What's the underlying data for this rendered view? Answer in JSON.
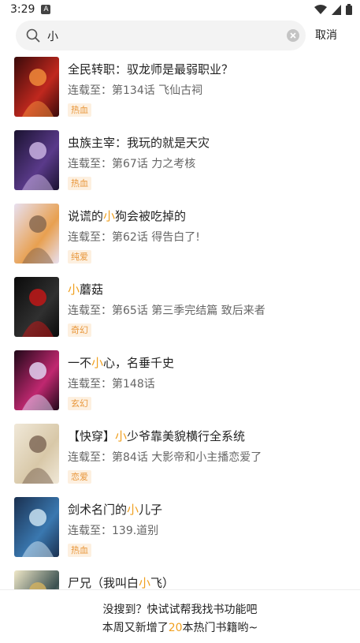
{
  "status": {
    "time": "3:29",
    "notif_glyph": "A"
  },
  "search": {
    "query": "小",
    "placeholder": "",
    "cancel_label": "取消"
  },
  "colors": {
    "accent": "#f0a020",
    "tag_bg": "#fdf0e0",
    "tag_text": "#e8963a"
  },
  "results": [
    {
      "title_parts": [
        "全民转职：驭龙师是最弱职业？"
      ],
      "highlight_index": -1,
      "latest": "连载至：第134话 飞仙古祠",
      "tag": "热血",
      "cover_colors": [
        "#3a0a0a",
        "#c0281e",
        "#f08a3a"
      ]
    },
    {
      "title_parts": [
        "虫族主宰：我玩的就是天灾"
      ],
      "highlight_index": -1,
      "latest": "连载至：第67话 力之考核",
      "tag": "热血",
      "cover_colors": [
        "#1a1230",
        "#5a3a8a",
        "#c8b0e0"
      ]
    },
    {
      "title_parts": [
        "说谎的",
        "小",
        "狗会被吃掉的"
      ],
      "highlight_index": 1,
      "latest": "连载至：第62话 得告白了!",
      "tag": "纯爱",
      "cover_colors": [
        "#e8e0f0",
        "#e8a050",
        "#8a6a50"
      ]
    },
    {
      "title_parts": [
        "小",
        "蘑菇"
      ],
      "highlight_index": 0,
      "latest": "连载至：第65话 第三季完结篇 致后来者",
      "tag": "奇幻",
      "cover_colors": [
        "#0a0a0a",
        "#303030",
        "#c01818"
      ]
    },
    {
      "title_parts": [
        "一不",
        "小",
        "心，名垂千史"
      ],
      "highlight_index": 1,
      "latest": "连载至：第148话",
      "tag": "玄幻",
      "cover_colors": [
        "#200818",
        "#c02870",
        "#e0d0f0"
      ]
    },
    {
      "title_parts": [
        "【快穿】",
        "小",
        "少爷靠美貌横行全系统"
      ],
      "highlight_index": 1,
      "latest": "连载至：第84话 大影帝和小主播恋爱了",
      "tag": "恋爱",
      "cover_colors": [
        "#f0e8d8",
        "#d8c8a8",
        "#806a58"
      ]
    },
    {
      "title_parts": [
        "剑术名门的",
        "小",
        "儿子"
      ],
      "highlight_index": 1,
      "latest": "连载至：139.道别",
      "tag": "热血",
      "cover_colors": [
        "#1a3050",
        "#3a78b0",
        "#c8e0f0"
      ]
    },
    {
      "title_parts": [
        "尸兄（我叫白",
        "小",
        "飞）"
      ],
      "highlight_index": 1,
      "latest": "",
      "tag": "",
      "cover_colors": [
        "#f0e8c8",
        "#3a5050",
        "#d0b060"
      ]
    }
  ],
  "footer": {
    "line1": "没搜到？快试试帮我找书功能吧",
    "line2_prefix": "本周又新增了",
    "line2_number": "20",
    "line2_suffix": "本热门书籍哟~"
  }
}
